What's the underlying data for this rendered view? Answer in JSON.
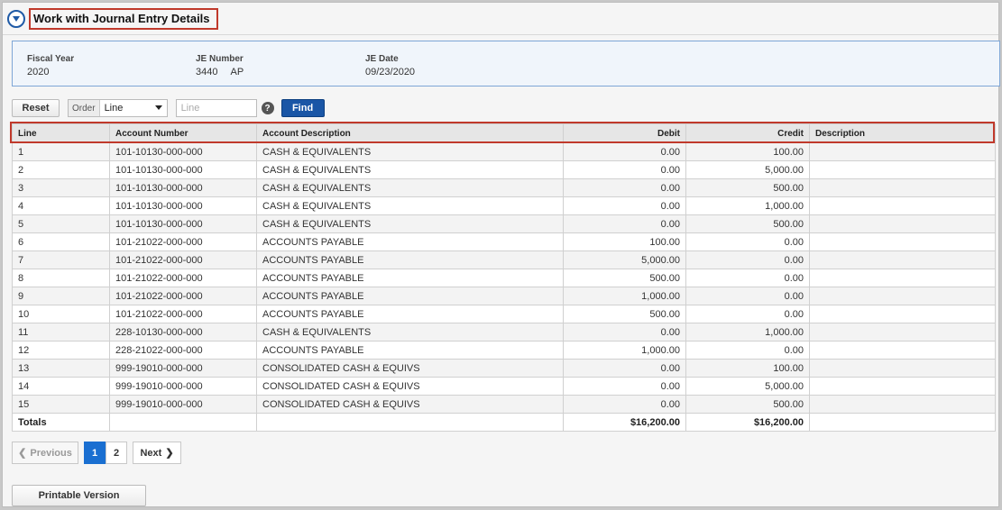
{
  "header": {
    "title": "Work with Journal Entry Details"
  },
  "info": {
    "fiscal_year_label": "Fiscal Year",
    "fiscal_year": "2020",
    "je_number_label": "JE Number",
    "je_number": "3440",
    "je_type": "AP",
    "je_date_label": "JE Date",
    "je_date": "09/23/2020"
  },
  "filter": {
    "reset_label": "Reset",
    "order_label": "Order",
    "order_value": "Line",
    "line_placeholder": "Line",
    "help_glyph": "?",
    "find_label": "Find"
  },
  "table": {
    "columns": [
      "Line",
      "Account Number",
      "Account Description",
      "Debit",
      "Credit",
      "Description"
    ],
    "rows": [
      [
        "1",
        "101-10130-000-000",
        "CASH & EQUIVALENTS",
        "0.00",
        "100.00",
        ""
      ],
      [
        "2",
        "101-10130-000-000",
        "CASH & EQUIVALENTS",
        "0.00",
        "5,000.00",
        ""
      ],
      [
        "3",
        "101-10130-000-000",
        "CASH & EQUIVALENTS",
        "0.00",
        "500.00",
        ""
      ],
      [
        "4",
        "101-10130-000-000",
        "CASH & EQUIVALENTS",
        "0.00",
        "1,000.00",
        ""
      ],
      [
        "5",
        "101-10130-000-000",
        "CASH & EQUIVALENTS",
        "0.00",
        "500.00",
        ""
      ],
      [
        "6",
        "101-21022-000-000",
        "ACCOUNTS PAYABLE",
        "100.00",
        "0.00",
        ""
      ],
      [
        "7",
        "101-21022-000-000",
        "ACCOUNTS PAYABLE",
        "5,000.00",
        "0.00",
        ""
      ],
      [
        "8",
        "101-21022-000-000",
        "ACCOUNTS PAYABLE",
        "500.00",
        "0.00",
        ""
      ],
      [
        "9",
        "101-21022-000-000",
        "ACCOUNTS PAYABLE",
        "1,000.00",
        "0.00",
        ""
      ],
      [
        "10",
        "101-21022-000-000",
        "ACCOUNTS PAYABLE",
        "500.00",
        "0.00",
        ""
      ],
      [
        "11",
        "228-10130-000-000",
        "CASH & EQUIVALENTS",
        "0.00",
        "1,000.00",
        ""
      ],
      [
        "12",
        "228-21022-000-000",
        "ACCOUNTS PAYABLE",
        "1,000.00",
        "0.00",
        ""
      ],
      [
        "13",
        "999-19010-000-000",
        "CONSOLIDATED CASH & EQUIVS",
        "0.00",
        "100.00",
        ""
      ],
      [
        "14",
        "999-19010-000-000",
        "CONSOLIDATED CASH & EQUIVS",
        "0.00",
        "5,000.00",
        ""
      ],
      [
        "15",
        "999-19010-000-000",
        "CONSOLIDATED CASH & EQUIVS",
        "0.00",
        "500.00",
        ""
      ]
    ],
    "totals_label": "Totals",
    "total_debit": "$16,200.00",
    "total_credit": "$16,200.00"
  },
  "pager": {
    "previous_label": "Previous",
    "pages": [
      "1",
      "2"
    ],
    "current_page": "1",
    "next_label": "Next"
  },
  "footer": {
    "printable_label": "Printable Version"
  },
  "colors": {
    "accent": "#1a56a6",
    "highlight_border": "#c0392b",
    "active_page": "#1a6fd1"
  }
}
